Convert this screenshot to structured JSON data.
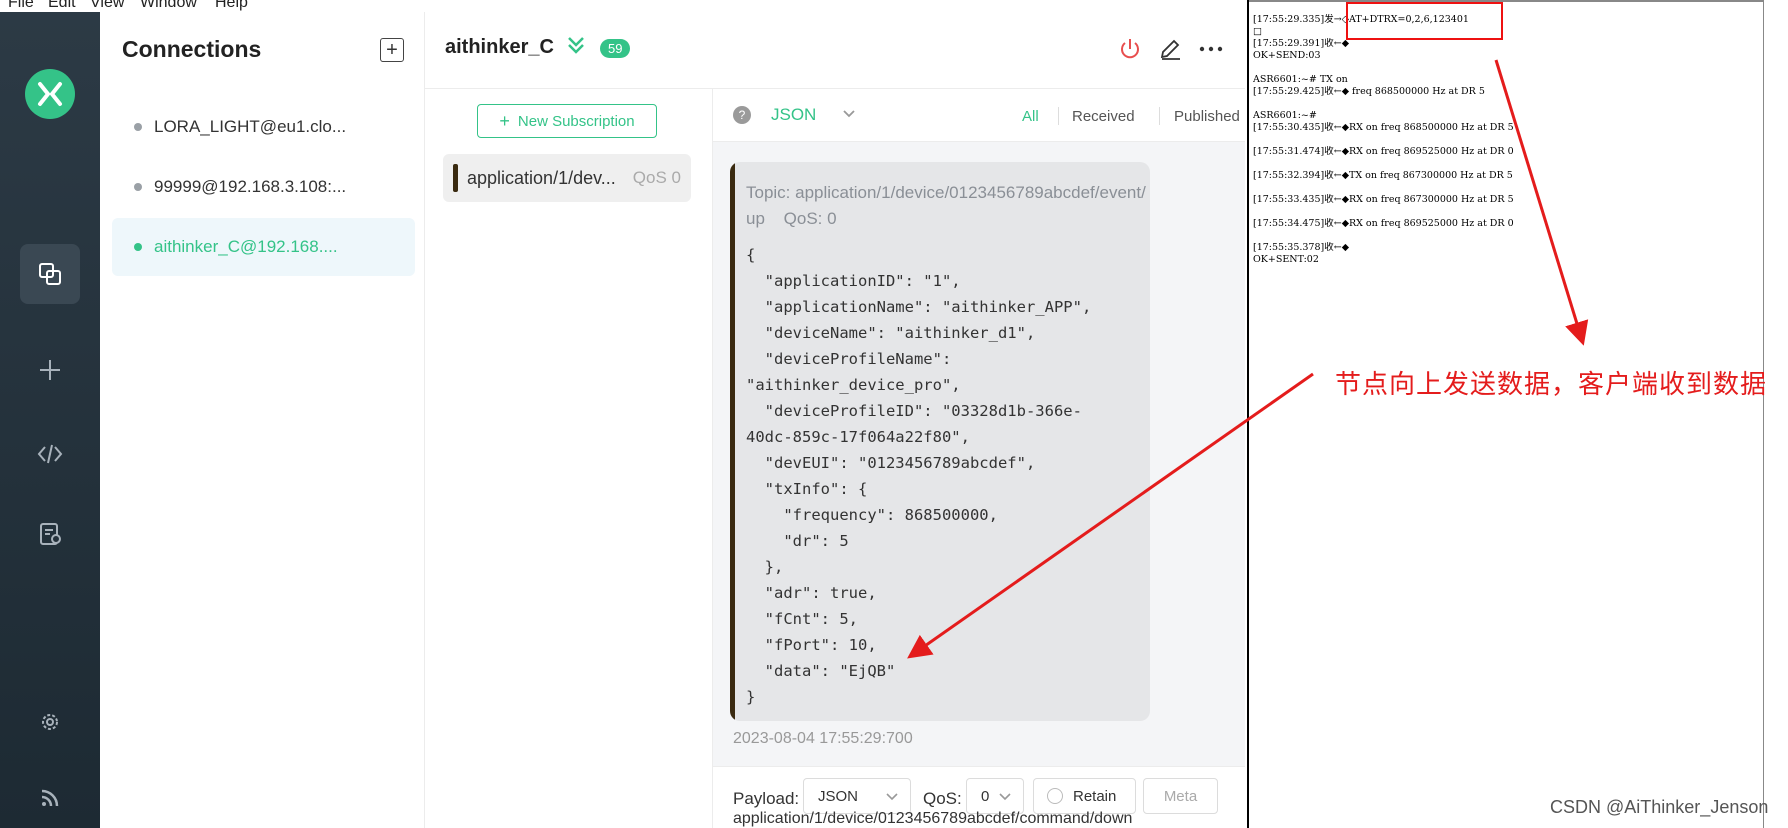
{
  "menu": [
    "File",
    "Edit",
    "View",
    "Window",
    "Help"
  ],
  "connections": {
    "title": "Connections",
    "items": [
      {
        "label": "LORA_LIGHT@eu1.clo..."
      },
      {
        "label": "99999@192.168.3.108:..."
      },
      {
        "label": "aithinker_C@192.168...."
      }
    ]
  },
  "header": {
    "name": "aithinker_C",
    "badge": "59"
  },
  "subscriptions": {
    "new_label": "New Subscription",
    "items": [
      {
        "topic": "application/1/dev...",
        "qos": "QoS 0"
      }
    ]
  },
  "messages": {
    "format": "JSON",
    "tabs": [
      "All",
      "Received",
      "Published"
    ],
    "topic_line": "Topic: application/1/device/0123456789abcdef/event/up",
    "qos_line": "QoS: 0",
    "payload": "{\n  \"applicationID\": \"1\",\n  \"applicationName\": \"aithinker_APP\",\n  \"deviceName\": \"aithinker_d1\",\n  \"deviceProfileName\":\n\"aithinker_device_pro\",\n  \"deviceProfileID\": \"03328d1b-366e-\n40dc-859c-17f064a22f80\",\n  \"devEUI\": \"0123456789abcdef\",\n  \"txInfo\": {\n    \"frequency\": 868500000,\n    \"dr\": 5\n  },\n  \"adr\": true,\n  \"fCnt\": 5,\n  \"fPort\": 10,\n  \"data\": \"EjQB\"\n}",
    "timestamp": "2023-08-04 17:55:29:700"
  },
  "compose": {
    "payload_label": "Payload:",
    "payload_format": "JSON",
    "qos_label": "QoS:",
    "qos_value": "0",
    "retain_label": "Retain",
    "meta_label": "Meta",
    "topic": "application/1/device/0123456789abcdef/command/down"
  },
  "serial_log": [
    "[17:55:29.335]发→◇AT+DTRX=0,2,6,123401",
    "□",
    "[17:55:29.391]收←◆",
    "OK+SEND:03",
    "",
    "ASR6601:~# TX on",
    "[17:55:29.425]收←◆ freq 868500000 Hz at DR 5",
    "",
    "ASR6601:~#",
    "[17:55:30.435]收←◆RX on freq 868500000 Hz at DR 5",
    "",
    "[17:55:31.474]收←◆RX on freq 869525000 Hz at DR 0",
    "",
    "[17:55:32.394]收←◆TX on freq 867300000 Hz at DR 5",
    "",
    "[17:55:33.435]收←◆RX on freq 867300000 Hz at DR 5",
    "",
    "[17:55:34.475]收←◆RX on freq 869525000 Hz at DR 0",
    "",
    "[17:55:35.378]收←◆",
    "OK+SENT:02"
  ],
  "annotation": "节点向上发送数据，客户端收到数据",
  "watermark": "CSDN @AiThinker_Jenson",
  "colors": {
    "accent": "#34c388",
    "annotation": "#e41c1c",
    "nav_bg": "#2c3a45"
  }
}
